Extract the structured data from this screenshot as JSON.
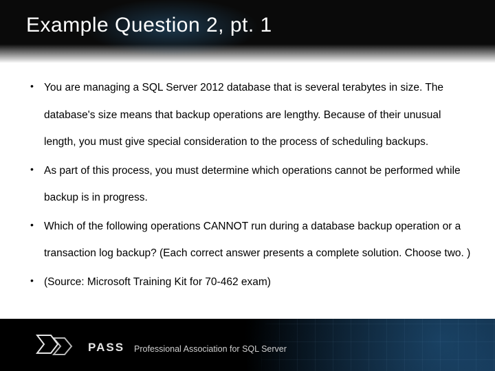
{
  "title": "Example Question 2, pt. 1",
  "bullets": [
    "You are managing a SQL Server 2012 database that is several terabytes in size. The database's size means that backup operations are lengthy. Because of their unusual length, you must give special consideration to the process of scheduling backups.",
    "As part of this process, you must determine which operations cannot be performed while backup is in progress.",
    "Which of the following operations CANNOT run during a database backup operation or a transaction log backup? (Each correct answer presents a complete solution. Choose two. )",
    "(Source: Microsoft Training Kit for 70-462 exam)"
  ],
  "footer": {
    "org_short": "PASS",
    "org_full": "Professional Association for SQL Server"
  }
}
